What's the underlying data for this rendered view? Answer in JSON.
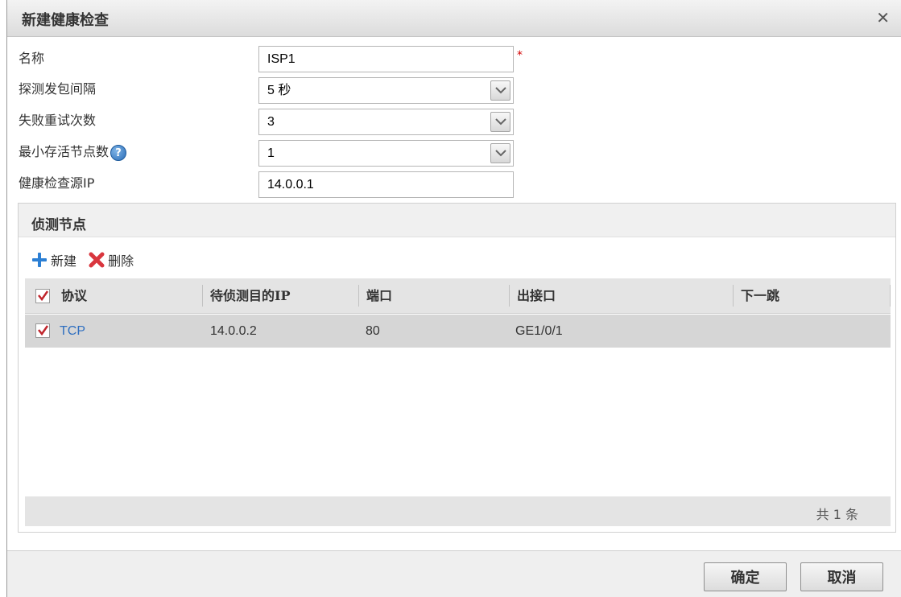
{
  "dialog": {
    "title": "新建健康检查",
    "close_glyph": "✕"
  },
  "form": {
    "name": {
      "label": "名称",
      "value": "ISP1",
      "required_mark": "*"
    },
    "interval": {
      "label": "探测发包间隔",
      "value": "5 秒"
    },
    "retries": {
      "label": "失败重试次数",
      "value": "3"
    },
    "min_alive": {
      "label": "最小存活节点数",
      "value": "1",
      "help_glyph": "?"
    },
    "source_ip": {
      "label": "健康检查源IP",
      "value": "14.0.0.1"
    }
  },
  "panel": {
    "title": "侦测节点",
    "toolbar": {
      "add_label": "新建",
      "delete_label": "删除"
    },
    "columns": [
      "协议",
      "待侦测目的IP",
      "端口",
      "出接口",
      "下一跳"
    ],
    "rows": [
      {
        "protocol": "TCP",
        "dest_ip": "14.0.0.2",
        "port": "80",
        "interface": "GE1/0/1",
        "next_hop": ""
      }
    ],
    "total_label": "共 1 条"
  },
  "buttons": {
    "ok_label": "确定",
    "cancel_label": "取消"
  },
  "colors": {
    "link": "#2f6fc0",
    "required": "#d40000",
    "check": "#c0262d",
    "add_icon": "#2c7fd4",
    "delete_icon": "#d9363e"
  }
}
